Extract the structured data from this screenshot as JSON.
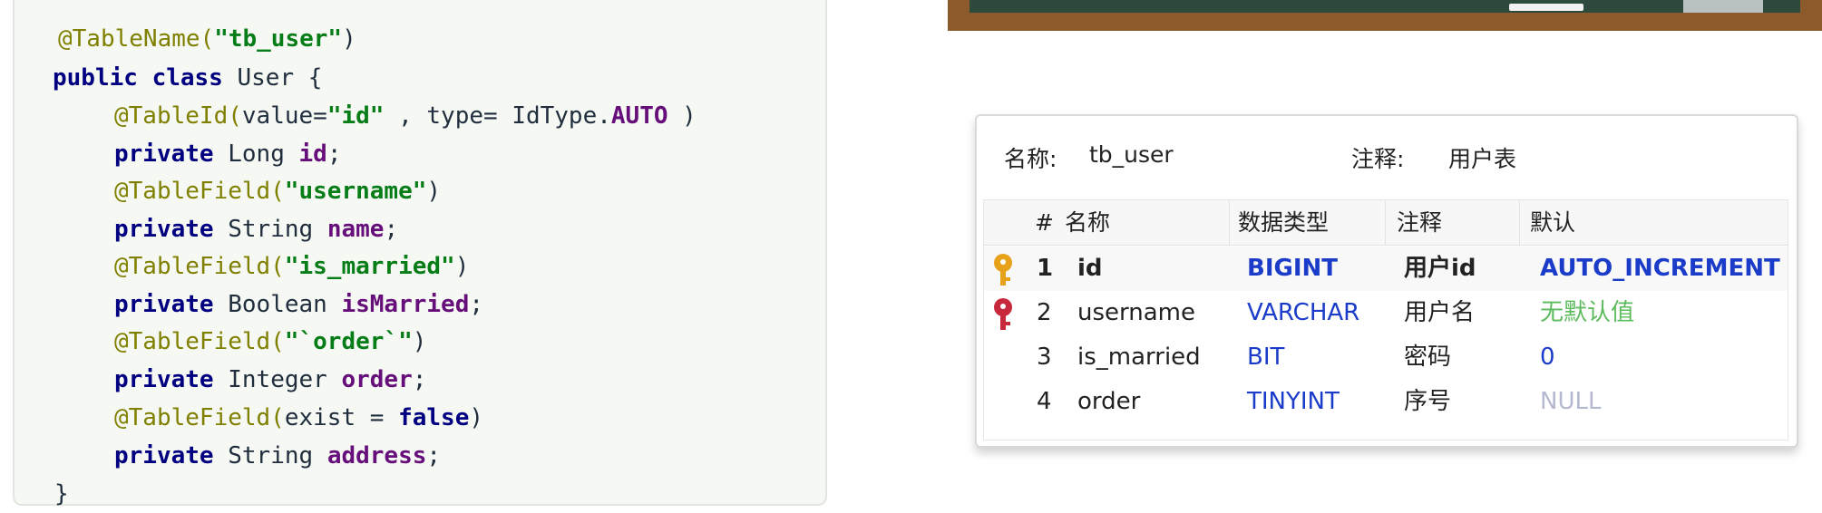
{
  "code": {
    "lines": [
      [
        "@TableName(",
        "\"tb_user\"",
        ")"
      ],
      [
        "public class",
        " User {"
      ],
      [
        "@TableId(",
        "value=",
        "\"id\"",
        " , type= IdType.",
        "AUTO",
        " )"
      ],
      [
        "private",
        " Long ",
        "id",
        ";"
      ],
      [
        "@TableField(",
        "\"username\"",
        ")"
      ],
      [
        "private",
        " String ",
        "name",
        ";"
      ],
      [
        "@TableField(",
        "\"is_married\"",
        ")"
      ],
      [
        "private",
        " Boolean ",
        "isMarried",
        ";"
      ],
      [
        "@TableField(",
        "\"`order`\"",
        ")"
      ],
      [
        "private",
        " Integer ",
        "order",
        ";"
      ],
      [
        "@TableField(",
        "exist = ",
        "false",
        ")"
      ],
      [
        "private",
        " String ",
        "address",
        ";"
      ],
      [
        "}"
      ]
    ]
  },
  "table_info": {
    "name_label": "名称:",
    "name_value": "tb_user",
    "comment_label": "注释:",
    "comment_value": "用户表"
  },
  "columns": [
    "#",
    "名称",
    "数据类型",
    "注释",
    "默认"
  ],
  "rows": [
    {
      "num": "1",
      "name": "id",
      "type": "BIGINT",
      "comment": "用户id",
      "default": "AUTO_INCREMENT",
      "key_icon": "primary-key-icon",
      "key_color": "#e8a21a",
      "default_color": "#1a3cc8",
      "bold": true
    },
    {
      "num": "2",
      "name": "username",
      "type": "VARCHAR",
      "comment": "用户名",
      "default": "无默认值",
      "key_icon": "unique-key-icon",
      "key_color": "#c8283c",
      "default_color": "#5dbb5d",
      "bold": false
    },
    {
      "num": "3",
      "name": "is_married",
      "type": "BIT",
      "comment": "密码",
      "default": "0",
      "key_icon": "",
      "key_color": "",
      "default_color": "#1a3cc8",
      "bold": false
    },
    {
      "num": "4",
      "name": "order",
      "type": "TINYINT",
      "comment": "序号",
      "default": "NULL",
      "key_icon": "",
      "key_color": "",
      "default_color": "#b4b8d0",
      "bold": false
    }
  ],
  "colors": {
    "type_blue": "#1a3cc8",
    "accent_bg": "#f6f8f4"
  }
}
